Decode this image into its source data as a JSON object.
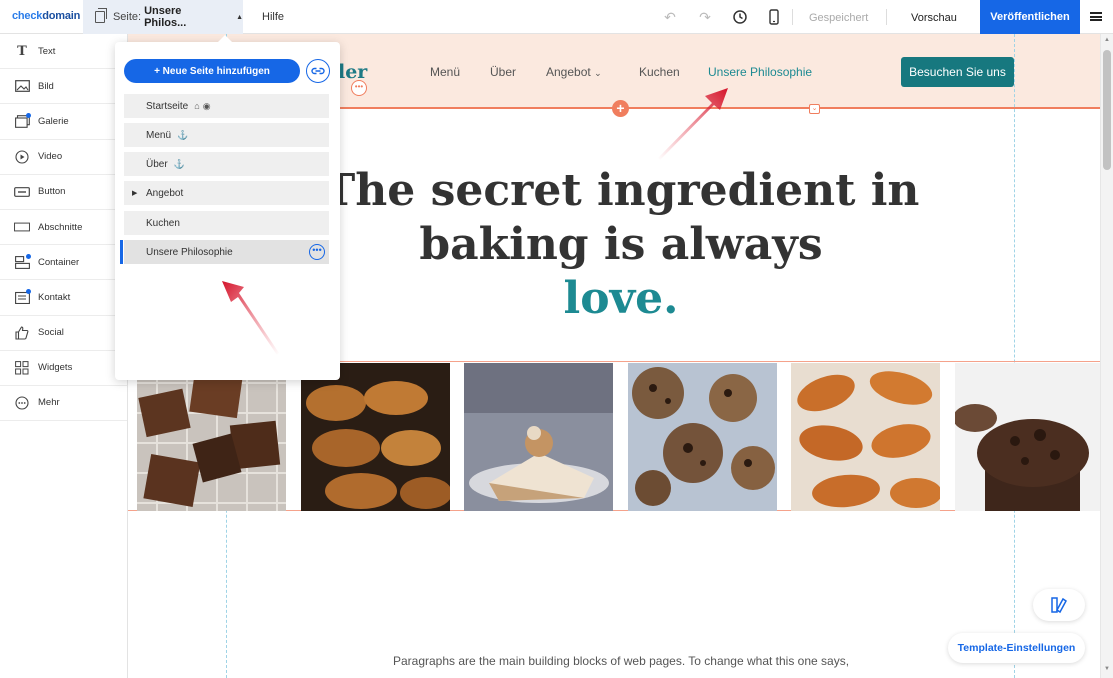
{
  "app": {
    "logo_text_a": "check",
    "logo_text_b": "domain",
    "page_selector_prefix": "Seite:",
    "page_selector_value": "Unsere Philos...",
    "help": "Hilfe",
    "saved_status": "Gespeichert",
    "preview": "Vorschau",
    "publish": "Veröffentlichen",
    "accent_color": "#1667e6"
  },
  "sidebar": {
    "items": [
      {
        "label": "Text",
        "icon": "text-icon"
      },
      {
        "label": "Bild",
        "icon": "image-icon"
      },
      {
        "label": "Galerie",
        "icon": "gallery-icon"
      },
      {
        "label": "Video",
        "icon": "video-icon"
      },
      {
        "label": "Button",
        "icon": "button-icon"
      },
      {
        "label": "Abschnitte",
        "icon": "section-icon"
      },
      {
        "label": "Container",
        "icon": "container-icon"
      },
      {
        "label": "Kontakt",
        "icon": "contact-icon"
      },
      {
        "label": "Social",
        "icon": "social-icon"
      },
      {
        "label": "Widgets",
        "icon": "widgets-icon"
      },
      {
        "label": "Mehr",
        "icon": "more-icon"
      }
    ]
  },
  "page_panel": {
    "new_page_button": "+ Neue Seite hinzufügen",
    "pages": [
      {
        "label": "Startseite"
      },
      {
        "label": "Menü"
      },
      {
        "label": "Über"
      },
      {
        "label": "Angebot"
      },
      {
        "label": "Kuchen"
      },
      {
        "label": "Unsere Philosophie"
      }
    ]
  },
  "site": {
    "brand_fragment": "ler",
    "nav": [
      "Menü",
      "Über",
      "Angebot",
      "Kuchen",
      "Unsere Philosophie"
    ],
    "cta": "Besuchen Sie uns",
    "hero_line1": "The secret ingredient in",
    "hero_line2": "baking is always",
    "hero_accent": "love.",
    "paragraph": "Paragraphs are the main building blocks of web pages. To change what this one says,",
    "header_bg": "#fbe9df",
    "teal": "#17787f"
  },
  "floating": {
    "template_settings": "Template-Einstellungen"
  }
}
